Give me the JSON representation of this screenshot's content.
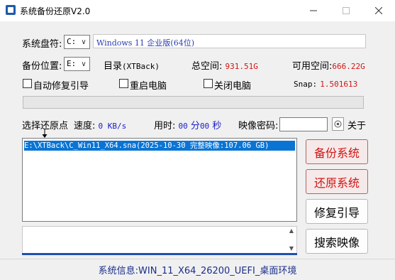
{
  "window": {
    "title": "系统备份还原V2.0"
  },
  "system_disk": {
    "label": "系统盘符:",
    "drive": "C:",
    "info": "Windows 11 企业版(64位)"
  },
  "backup": {
    "label": "备份位置:",
    "drive": "E:",
    "dir_label": "目录",
    "dir_value": "(XTBack)",
    "total_label": "总空间:",
    "total_value": "931.51G",
    "free_label": "可用空间:",
    "free_value": "666.22G"
  },
  "options": {
    "auto_fix": "自动修复引导",
    "restart": "重启电脑",
    "shutdown": "关闭电脑"
  },
  "snap": {
    "label": "Snap:",
    "value": "1.501613"
  },
  "restore_point": {
    "label": "选择还原点",
    "speed_label": "速度:",
    "speed_value": "0 KB/s",
    "time_label": "用时:",
    "time_min": "00",
    "min_unit": "分",
    "time_sec": "00",
    "sec_unit": "秒",
    "pwd_label": "映像密码:",
    "about": "关于"
  },
  "list": {
    "items": [
      "E:\\XTBack\\C_Win11_X64.sna(2025-10-30 完整映像:107.06 GB)"
    ]
  },
  "buttons": {
    "backup": "备份系统",
    "restore": "还原系统",
    "fix_boot": "修复引导",
    "search_image": "搜索映像"
  },
  "status": {
    "text": "系统信息:WIN_11_X64_26200_UEFI_桌面环境"
  },
  "colors": {
    "accent_red": "#d11414",
    "accent_blue": "#1f4fb0",
    "list_selection": "#0a74d4"
  }
}
